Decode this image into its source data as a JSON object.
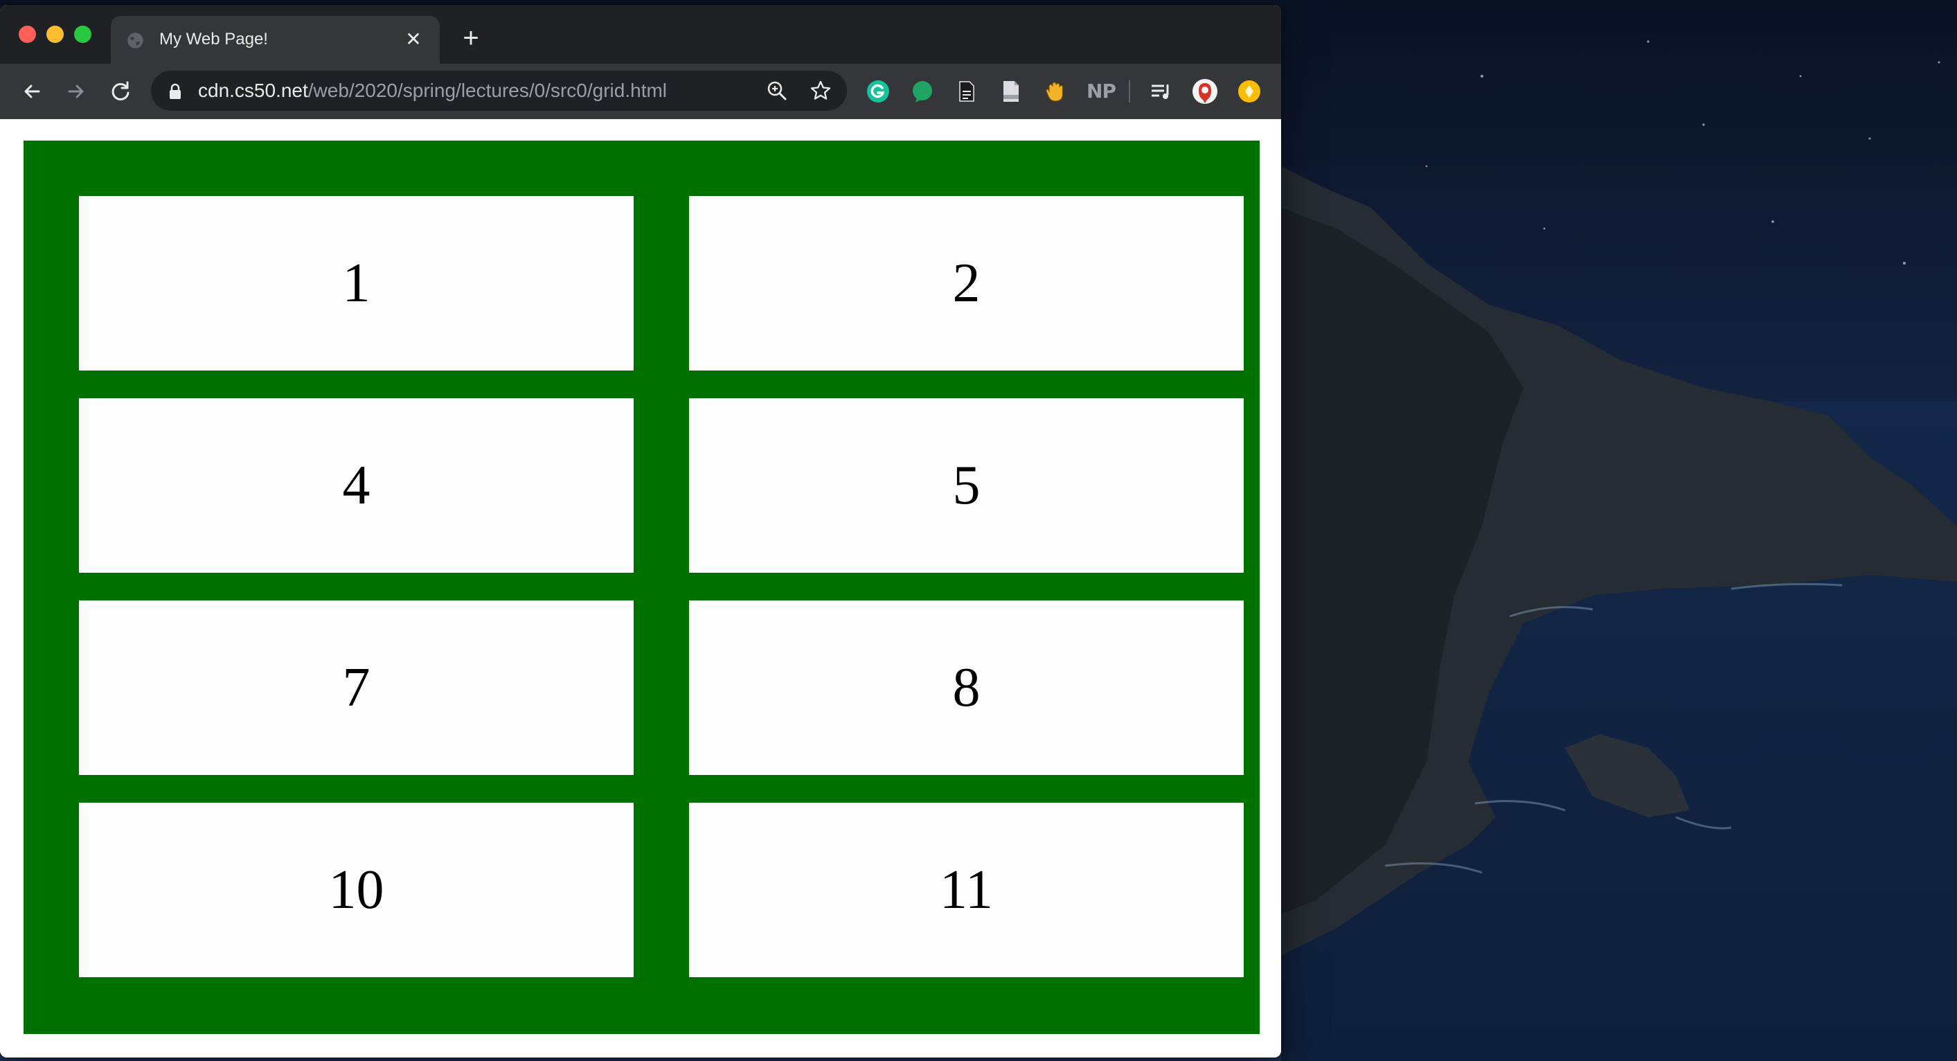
{
  "window": {
    "tab_title": "My Web Page!",
    "url_host": "cdn.cs50.net",
    "url_path": "/web/2020/spring/lectures/0/src0/grid.html"
  },
  "extensions": {
    "np_label": "NP"
  },
  "page": {
    "grid_items": [
      "1",
      "2",
      "4",
      "5",
      "7",
      "8",
      "10",
      "11"
    ]
  },
  "colors": {
    "grid_background": "#007000",
    "grid_item_background": "#fdfdfd",
    "tabstrip": "#202124",
    "toolbar": "#35363a"
  }
}
